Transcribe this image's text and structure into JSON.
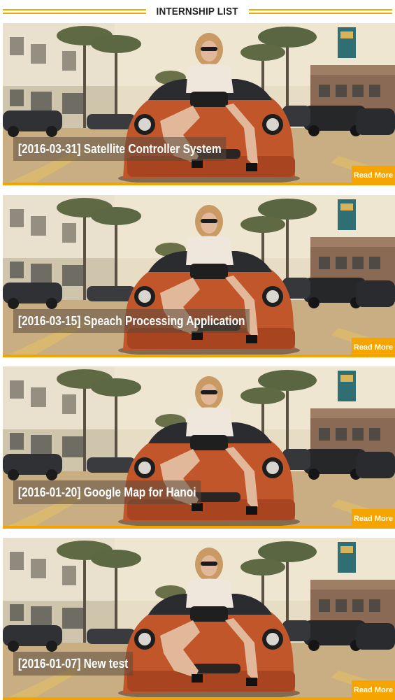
{
  "section": {
    "title": "INTERNSHIP LIST"
  },
  "colors": {
    "accent": "#f4a300",
    "title_bg": "rgba(90,75,60,0.55)"
  },
  "internships": [
    {
      "title": "[2016-03-31] Satellite Controller System",
      "read_more": "Read More"
    },
    {
      "title": "[2016-03-15] Speach Processing Application",
      "read_more": "Read More"
    },
    {
      "title": "[2016-01-20] Google Map for Hanoi",
      "read_more": "Read More"
    },
    {
      "title": "[2016-01-07] New test",
      "read_more": "Read More"
    }
  ]
}
